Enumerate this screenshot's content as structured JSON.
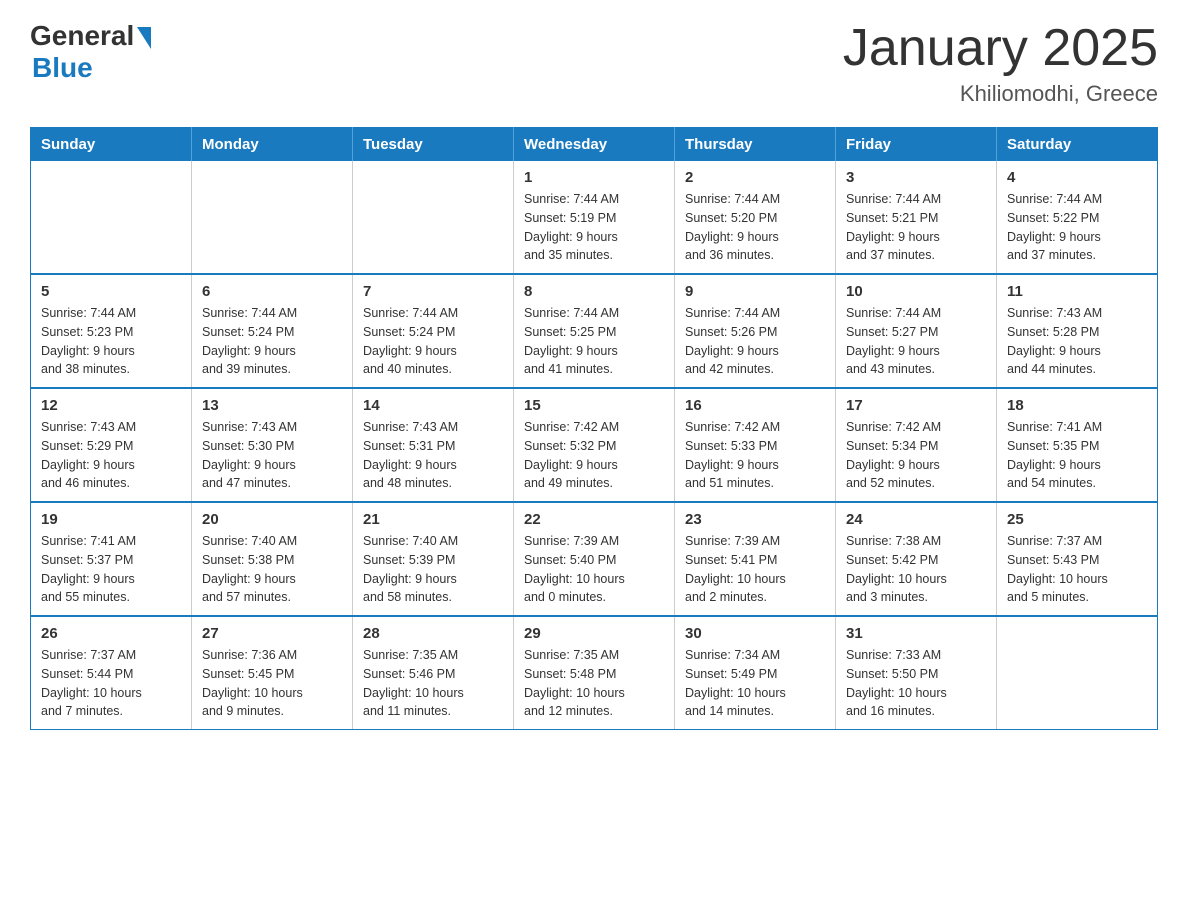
{
  "logo": {
    "general": "General",
    "blue": "Blue"
  },
  "title": "January 2025",
  "subtitle": "Khiliomodhi, Greece",
  "weekdays": [
    "Sunday",
    "Monday",
    "Tuesday",
    "Wednesday",
    "Thursday",
    "Friday",
    "Saturday"
  ],
  "weeks": [
    [
      {
        "day": "",
        "info": ""
      },
      {
        "day": "",
        "info": ""
      },
      {
        "day": "",
        "info": ""
      },
      {
        "day": "1",
        "info": "Sunrise: 7:44 AM\nSunset: 5:19 PM\nDaylight: 9 hours\nand 35 minutes."
      },
      {
        "day": "2",
        "info": "Sunrise: 7:44 AM\nSunset: 5:20 PM\nDaylight: 9 hours\nand 36 minutes."
      },
      {
        "day": "3",
        "info": "Sunrise: 7:44 AM\nSunset: 5:21 PM\nDaylight: 9 hours\nand 37 minutes."
      },
      {
        "day": "4",
        "info": "Sunrise: 7:44 AM\nSunset: 5:22 PM\nDaylight: 9 hours\nand 37 minutes."
      }
    ],
    [
      {
        "day": "5",
        "info": "Sunrise: 7:44 AM\nSunset: 5:23 PM\nDaylight: 9 hours\nand 38 minutes."
      },
      {
        "day": "6",
        "info": "Sunrise: 7:44 AM\nSunset: 5:24 PM\nDaylight: 9 hours\nand 39 minutes."
      },
      {
        "day": "7",
        "info": "Sunrise: 7:44 AM\nSunset: 5:24 PM\nDaylight: 9 hours\nand 40 minutes."
      },
      {
        "day": "8",
        "info": "Sunrise: 7:44 AM\nSunset: 5:25 PM\nDaylight: 9 hours\nand 41 minutes."
      },
      {
        "day": "9",
        "info": "Sunrise: 7:44 AM\nSunset: 5:26 PM\nDaylight: 9 hours\nand 42 minutes."
      },
      {
        "day": "10",
        "info": "Sunrise: 7:44 AM\nSunset: 5:27 PM\nDaylight: 9 hours\nand 43 minutes."
      },
      {
        "day": "11",
        "info": "Sunrise: 7:43 AM\nSunset: 5:28 PM\nDaylight: 9 hours\nand 44 minutes."
      }
    ],
    [
      {
        "day": "12",
        "info": "Sunrise: 7:43 AM\nSunset: 5:29 PM\nDaylight: 9 hours\nand 46 minutes."
      },
      {
        "day": "13",
        "info": "Sunrise: 7:43 AM\nSunset: 5:30 PM\nDaylight: 9 hours\nand 47 minutes."
      },
      {
        "day": "14",
        "info": "Sunrise: 7:43 AM\nSunset: 5:31 PM\nDaylight: 9 hours\nand 48 minutes."
      },
      {
        "day": "15",
        "info": "Sunrise: 7:42 AM\nSunset: 5:32 PM\nDaylight: 9 hours\nand 49 minutes."
      },
      {
        "day": "16",
        "info": "Sunrise: 7:42 AM\nSunset: 5:33 PM\nDaylight: 9 hours\nand 51 minutes."
      },
      {
        "day": "17",
        "info": "Sunrise: 7:42 AM\nSunset: 5:34 PM\nDaylight: 9 hours\nand 52 minutes."
      },
      {
        "day": "18",
        "info": "Sunrise: 7:41 AM\nSunset: 5:35 PM\nDaylight: 9 hours\nand 54 minutes."
      }
    ],
    [
      {
        "day": "19",
        "info": "Sunrise: 7:41 AM\nSunset: 5:37 PM\nDaylight: 9 hours\nand 55 minutes."
      },
      {
        "day": "20",
        "info": "Sunrise: 7:40 AM\nSunset: 5:38 PM\nDaylight: 9 hours\nand 57 minutes."
      },
      {
        "day": "21",
        "info": "Sunrise: 7:40 AM\nSunset: 5:39 PM\nDaylight: 9 hours\nand 58 minutes."
      },
      {
        "day": "22",
        "info": "Sunrise: 7:39 AM\nSunset: 5:40 PM\nDaylight: 10 hours\nand 0 minutes."
      },
      {
        "day": "23",
        "info": "Sunrise: 7:39 AM\nSunset: 5:41 PM\nDaylight: 10 hours\nand 2 minutes."
      },
      {
        "day": "24",
        "info": "Sunrise: 7:38 AM\nSunset: 5:42 PM\nDaylight: 10 hours\nand 3 minutes."
      },
      {
        "day": "25",
        "info": "Sunrise: 7:37 AM\nSunset: 5:43 PM\nDaylight: 10 hours\nand 5 minutes."
      }
    ],
    [
      {
        "day": "26",
        "info": "Sunrise: 7:37 AM\nSunset: 5:44 PM\nDaylight: 10 hours\nand 7 minutes."
      },
      {
        "day": "27",
        "info": "Sunrise: 7:36 AM\nSunset: 5:45 PM\nDaylight: 10 hours\nand 9 minutes."
      },
      {
        "day": "28",
        "info": "Sunrise: 7:35 AM\nSunset: 5:46 PM\nDaylight: 10 hours\nand 11 minutes."
      },
      {
        "day": "29",
        "info": "Sunrise: 7:35 AM\nSunset: 5:48 PM\nDaylight: 10 hours\nand 12 minutes."
      },
      {
        "day": "30",
        "info": "Sunrise: 7:34 AM\nSunset: 5:49 PM\nDaylight: 10 hours\nand 14 minutes."
      },
      {
        "day": "31",
        "info": "Sunrise: 7:33 AM\nSunset: 5:50 PM\nDaylight: 10 hours\nand 16 minutes."
      },
      {
        "day": "",
        "info": ""
      }
    ]
  ]
}
